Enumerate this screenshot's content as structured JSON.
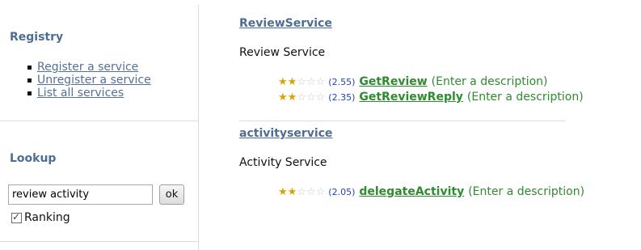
{
  "sidebar": {
    "registry_heading": "Registry",
    "registry_links": [
      {
        "label": "Register a service"
      },
      {
        "label": "Unregister a service"
      },
      {
        "label": "List all services"
      }
    ],
    "lookup_heading": "Lookup",
    "search": {
      "value": "review activity"
    },
    "ok_label": "ok",
    "ranking": {
      "label": "Ranking",
      "checked": true
    }
  },
  "services": [
    {
      "name": "ReviewService",
      "description": "Review Service",
      "operations": [
        {
          "stars": 2,
          "rating": "(2.55)",
          "name": "GetReview",
          "description": "(Enter a description)"
        },
        {
          "stars": 2,
          "rating": "(2.35)",
          "name": "GetReviewReply",
          "description": "(Enter a description)"
        }
      ]
    },
    {
      "name": "activityservice",
      "description": "Activity Service",
      "operations": [
        {
          "stars": 2,
          "rating": "(2.05)",
          "name": "delegateActivity",
          "description": "(Enter a description)"
        }
      ]
    }
  ],
  "colors": {
    "heading": "#4d6d94",
    "link": "#54709a",
    "operation": "#2e8b2e",
    "rating": "#2240c0",
    "star_on": "#e0a000"
  }
}
